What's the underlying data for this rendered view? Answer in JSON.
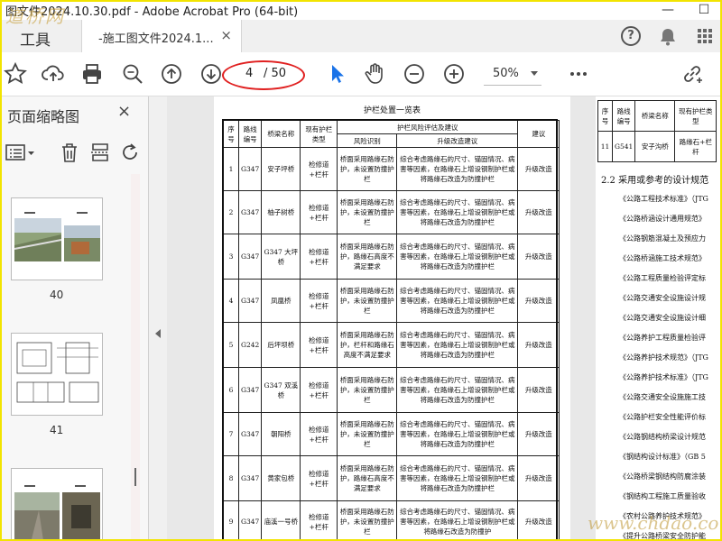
{
  "window": {
    "title": "图文件2024.10.30.pdf - Adobe Acrobat Pro (64-bit)",
    "min_label": "—",
    "max_label": "☐"
  },
  "watermark": {
    "top_left": "道桥网",
    "bottom_right": "www.chdao.com"
  },
  "tabs": {
    "tools_label": "工具",
    "doc_tab_label": "-施工图文件2024.1...",
    "doc_tab_close": "×",
    "help_label": "?"
  },
  "toolbar": {
    "page_current": "4",
    "page_total": "/ 50",
    "zoom_value": "50%"
  },
  "sidebar": {
    "title": "页面缩略图",
    "close_label": "×",
    "thumbnails": [
      {
        "num": "40"
      },
      {
        "num": "41"
      }
    ]
  },
  "page_main": {
    "table_title": "护栏处置一览表",
    "headers": {
      "no": "序号",
      "route": "路线编号",
      "bridge": "桥梁名称",
      "current": "现有护栏类型",
      "risk_group": "护栏风险评估及建议",
      "risk_id": "风险识别",
      "upgrade": "升级改造建议",
      "advice": "建议"
    },
    "rows": [
      {
        "no": "1",
        "route": "G347",
        "bridge": "安子坪桥",
        "current": "检修道+栏杆",
        "risk": "桥面采用路缘石防护，未设置防撞护栏",
        "upgrade": "综合考虑路缘石的尺寸、锚固情况、病害等因素，在路缘石上增设钢制护栏或将路缘石改造为防撞护栏",
        "advice": "升级改造"
      },
      {
        "no": "2",
        "route": "G347",
        "bridge": "柚子树桥",
        "current": "检修道+栏杆",
        "risk": "桥面采用路缘石防护，未设置防撞护栏",
        "upgrade": "综合考虑路缘石的尺寸、锚固情况、病害等因素，在路缘石上增设钢制护栏或将路缘石改造为防撞护栏",
        "advice": "升级改造"
      },
      {
        "no": "3",
        "route": "G347",
        "bridge": "G347 大坪桥",
        "current": "检修道+栏杆",
        "risk": "桥面采用路缘石防护，路缘石高度不满足要求",
        "upgrade": "综合考虑路缘石的尺寸、锚固情况、病害等因素，在路缘石上增设钢制护栏或将路缘石改造为防撞护栏",
        "advice": "升级改造"
      },
      {
        "no": "4",
        "route": "G347",
        "bridge": "凤凰桥",
        "current": "检修道+栏杆",
        "risk": "桥面采用路缘石防护，未设置防撞护栏",
        "upgrade": "综合考虑路缘石的尺寸、锚固情况、病害等因素，在路缘石上增设钢制护栏或将路缘石改造为防撞护栏",
        "advice": "升级改造"
      },
      {
        "no": "5",
        "route": "G242",
        "bridge": "后坪坝桥",
        "current": "检修道+栏杆",
        "risk": "桥面采用路缘石防护，栏杆和路缘石高度不满足要求",
        "upgrade": "综合考虑路缘石的尺寸、锚固情况、病害等因素，在路缘石上增设钢制护栏或将路缘石改造为防撞护栏",
        "advice": "升级改造"
      },
      {
        "no": "6",
        "route": "G347",
        "bridge": "G347 双溪桥",
        "current": "检修道+栏杆",
        "risk": "桥面采用路缘石防护，未设置防撞护栏",
        "upgrade": "综合考虑路缘石的尺寸、锚固情况、病害等因素，在路缘石上增设钢制护栏或将路缘石改造为防撞护栏",
        "advice": "升级改造"
      },
      {
        "no": "7",
        "route": "G347",
        "bridge": "朝阳桥",
        "current": "检修道+栏杆",
        "risk": "桥面采用路缘石防护，未设置防撞护栏",
        "upgrade": "综合考虑路缘石的尺寸、锚固情况、病害等因素，在路缘石上增设钢制护栏或将路缘石改造为防撞护栏",
        "advice": "升级改造"
      },
      {
        "no": "8",
        "route": "G347",
        "bridge": "黄家包桥",
        "current": "检修道+栏杆",
        "risk": "桥面采用路缘石防护，路缘石高度不满足要求",
        "upgrade": "综合考虑路缘石的尺寸、锚固情况、病害等因素，在路缘石上增设钢制护栏或将路缘石改造为防撞护栏",
        "advice": "升级改造"
      },
      {
        "no": "9",
        "route": "G347",
        "bridge": "庙溪一号桥",
        "current": "检修道+栏杆",
        "risk": "桥面采用路缘石防护，未设置防撞护栏",
        "upgrade": "综合考虑路缘石的尺寸、锚固情况、病害等因素，在路缘石上增设钢制护栏或将路缘石改造为防撞护",
        "advice": "升级改造"
      }
    ]
  },
  "page_right": {
    "headers": {
      "no": "序号",
      "route": "路线编号",
      "bridge": "桥梁名称",
      "current": "现有护栏类型"
    },
    "row": {
      "no": "11",
      "route": "G541",
      "bridge": "安子沟桥",
      "current": "路缘石+栏杆"
    },
    "section_title": "2.2 采用或参考的设计规范",
    "refs": [
      "《公路工程技术标准》（JTG",
      "《公路桥涵设计通用规范》",
      "《公路钢筋混凝土及预应力",
      "《公路桥涵施工技术规范》",
      "《公路工程质量检验评定标",
      "《公路交通安全设施设计规",
      "《公路交通安全设施设计细",
      "《公路养护工程质量检验评",
      "《公路养护技术规范》（JTG",
      "《公路养护技术标准》（JTG",
      "《公路交通安全设施施工技",
      "《公路护栏安全性能评价标",
      "《公路钢结构桥梁设计规范",
      "《钢结构设计标准》（GB 5",
      "《公路桥梁钢结构防腐涂装",
      "《钢结构工程施工质量验收",
      "《农村公路养护技术规范》",
      "《提升公路桥梁安全防护能"
    ]
  }
}
